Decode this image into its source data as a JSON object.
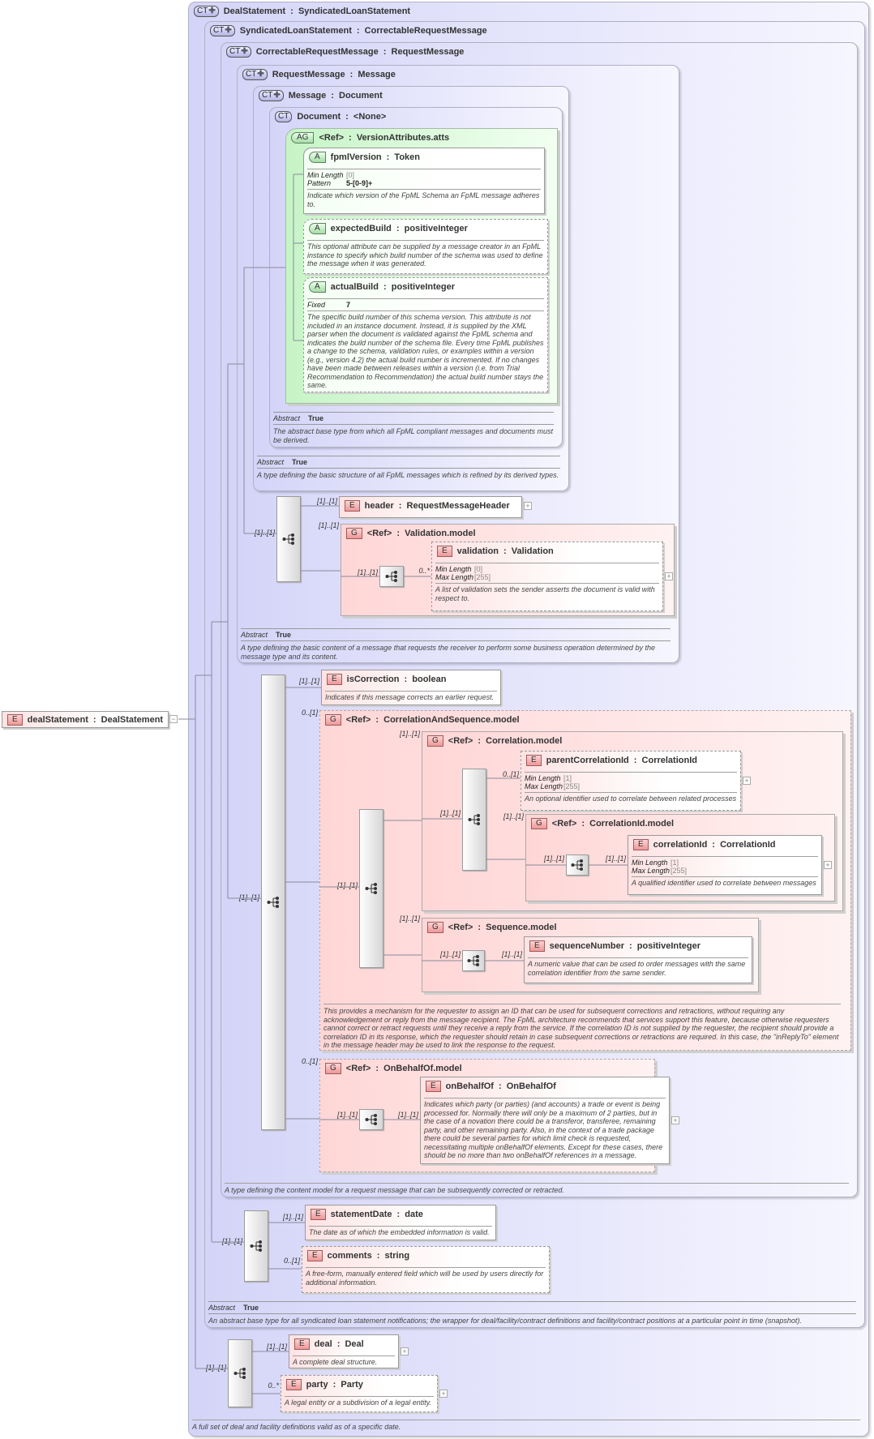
{
  "root": {
    "badge": "E",
    "name": "dealStatement",
    "type": "DealStatement"
  },
  "nodes": {
    "ctDealStatement": {
      "badge": "CT",
      "name": "DealStatement",
      "type": "SyndicatedLoanStatement",
      "description": "A full set of deal and facility definitions valid as of a specific date."
    },
    "ctSyndicated": {
      "badge": "CT",
      "name": "SyndicatedLoanStatement",
      "type": "CorrectableRequestMessage",
      "abstract_label": "Abstract",
      "abstract_value": "True",
      "description": "An abstract base type for all syndicated loan statement notifications; the wrapper for deal/facility/contract definitions and facility/contract positions at a particular point in time (snapshot)."
    },
    "ctCorrectable": {
      "badge": "CT",
      "name": "CorrectableRequestMessage",
      "type": "RequestMessage",
      "description": "A type defining the content model for a request message that can be subsequently corrected or retracted."
    },
    "ctRequest": {
      "badge": "CT",
      "name": "RequestMessage",
      "type": "Message",
      "abstract_label": "Abstract",
      "abstract_value": "True",
      "description": "A type defining the basic content of a message that requests the receiver to perform some business operation determined by the message type and its content."
    },
    "ctMessage": {
      "badge": "CT",
      "name": "Message",
      "type": "Document",
      "abstract_label": "Abstract",
      "abstract_value": "True",
      "description": "A type defining the basic structure of all FpML messages which is refined by its derived types."
    },
    "ctDocument": {
      "badge": "CT",
      "name": "Document",
      "type": "<None>",
      "abstract_label": "Abstract",
      "abstract_value": "True",
      "description": "The abstract base type from which all FpML compliant messages and documents must be derived."
    },
    "agVersion": {
      "badge": "AG",
      "name": "<Ref>",
      "type": "VersionAttributes.atts"
    },
    "fpmlVersion": {
      "badge": "A",
      "name": "fpmlVersion",
      "type": "Token",
      "facets": [
        {
          "label": "Min Length",
          "value": "[0]"
        },
        {
          "label": "Pattern",
          "value": "5-[0-9]+"
        }
      ],
      "description": "Indicate which version of the FpML Schema an FpML message adheres to."
    },
    "expectedBuild": {
      "badge": "A",
      "name": "expectedBuild",
      "type": "positiveInteger",
      "description": "This optional attribute can be supplied by a message creator in an FpML instance to specify which build number of the schema was used to define the message when it was generated."
    },
    "actualBuild": {
      "badge": "A",
      "name": "actualBuild",
      "type": "positiveInteger",
      "facets": [
        {
          "label": "Fixed",
          "value": "7"
        }
      ],
      "description": "The specific build number of this schema version. This attribute is not included in an instance document. Instead, it is supplied by the XML parser when the document is validated against the FpML schema and indicates the build number of the schema file. Every time FpML publishes a change to the schema, validation rules, or examples within a version (e.g., version 4.2) the actual build number is incremented. If no changes have been made between releases within a version (i.e. from Trial Recommendation to Recommendation) the actual build number stays the same."
    },
    "header": {
      "badge": "E",
      "name": "header",
      "type": "RequestMessageHeader",
      "card": "[1]..[1]"
    },
    "validationModel": {
      "badge": "G",
      "name": "<Ref>",
      "type": "Validation.model",
      "card": "[1]..[1]"
    },
    "validation": {
      "badge": "E",
      "name": "validation",
      "type": "Validation",
      "card": "0..*",
      "facets": [
        {
          "label": "Min Length",
          "value": "[0]"
        },
        {
          "label": "Max Length",
          "value": "[255]"
        }
      ],
      "description": "A list of validation sets the sender asserts the document is valid with respect to."
    },
    "isCorrection": {
      "badge": "E",
      "name": "isCorrection",
      "type": "boolean",
      "card": "[1]..[1]",
      "description": "Indicates if this message corrects an earlier request."
    },
    "corrSeqModel": {
      "badge": "G",
      "name": "<Ref>",
      "type": "CorrelationAndSequence.model",
      "card": "0..[1]",
      "description": "This provides a mechanism for the requester to assign an ID that can be used for subsequent corrections and retractions, without requiring any acknowledgement or reply from the message recipient. The FpML architecture recommends that services support this feature, because otherwise requesters cannot correct or retract requests until they receive a reply from the service. If the correlation ID is not supplied by the requester, the recipient should provide a correlation ID in its response, which the requester should retain in case subsequent corrections or retractions are required. In this case, the \"inReplyTo\" element in the message header may be used to link the response to the request."
    },
    "correlationModel": {
      "badge": "G",
      "name": "<Ref>",
      "type": "Correlation.model",
      "card": "[1]..[1]"
    },
    "parentCorrelationId": {
      "badge": "E",
      "name": "parentCorrelationId",
      "type": "CorrelationId",
      "card": "0..[1]",
      "facets": [
        {
          "label": "Min Length",
          "value": "[1]"
        },
        {
          "label": "Max Length",
          "value": "[255]"
        }
      ],
      "description": "An optional identifier used to correlate between related processes"
    },
    "correlationIdModel": {
      "badge": "G",
      "name": "<Ref>",
      "type": "CorrelationId.model",
      "card": "[1]..[1]"
    },
    "correlationId": {
      "badge": "E",
      "name": "correlationId",
      "type": "CorrelationId",
      "card": "[1]..[1]",
      "facets": [
        {
          "label": "Min Length",
          "value": "[1]"
        },
        {
          "label": "Max Length",
          "value": "[255]"
        }
      ],
      "description": "A qualified identifier used to correlate between messages"
    },
    "sequenceModel": {
      "badge": "G",
      "name": "<Ref>",
      "type": "Sequence.model",
      "card": "[1]..[1]"
    },
    "sequenceNumber": {
      "badge": "E",
      "name": "sequenceNumber",
      "type": "positiveInteger",
      "card": "[1]..[1]",
      "description": "A numeric value that can be used to order messages with the same correlation identifier from the same sender."
    },
    "onBehalfOfModel": {
      "badge": "G",
      "name": "<Ref>",
      "type": "OnBehalfOf.model",
      "card": "0..[1]"
    },
    "onBehalfOf": {
      "badge": "E",
      "name": "onBehalfOf",
      "type": "OnBehalfOf",
      "card": "[1]..[1]",
      "description": "Indicates which party (or parties) (and accounts) a trade or event is being processed for. Normally there will only be a maximum of 2 parties, but in the case of a novation there could be a transferor, transferee, remaining party, and other remaining party. Also, in the context of a trade package there could be several parties for which limit check is requested, necessitating multiple onBehalfOf elements. Except for these cases, there should be no more than two onBehalfOf references in a message."
    },
    "statementDate": {
      "badge": "E",
      "name": "statementDate",
      "type": "date",
      "card": "[1]..[1]",
      "description": "The date as of which the embedded information is valid."
    },
    "comments": {
      "badge": "E",
      "name": "comments",
      "type": "string",
      "card": "0..[1]",
      "description": "A free-form, manually entered field which will be used by users directly for additional information."
    },
    "deal": {
      "badge": "E",
      "name": "deal",
      "type": "Deal",
      "card": "[1]..[1]",
      "description": "A complete deal structure."
    },
    "party": {
      "badge": "E",
      "name": "party",
      "type": "Party",
      "card": "0..*",
      "description": "A legal entity or a subdivision of a legal entity."
    }
  },
  "compositors": {
    "seqRequest": {
      "card": "[1]..[1]"
    },
    "seqValidation": {
      "card": "[1]..[1]"
    },
    "seqCorrectable": {
      "card": "[1]..[1]"
    },
    "seqCorrSeq": {
      "card": "[1]..[1]"
    },
    "seqCorrelation": {
      "card": "[1]..[1]"
    },
    "seqCorrelationId": {
      "card": "[1]..[1]"
    },
    "seqSequence": {
      "card": "[1]..[1]"
    },
    "seqOnBehalfOf": {
      "card": "[1]..[1]"
    },
    "seqSyndicated": {
      "card": "[1]..[1]"
    },
    "seqDeal": {
      "card": "[1]..[1]"
    }
  }
}
